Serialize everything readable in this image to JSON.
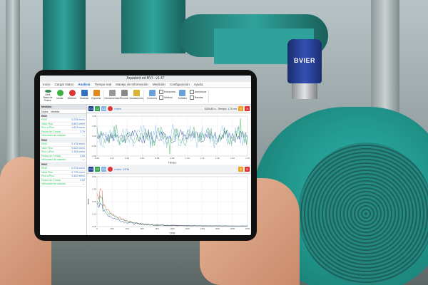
{
  "scene": {
    "sensor_label": "BVIER",
    "colors": {
      "motor": "#22998f",
      "sensor": "#2b43a0",
      "skin": "#d9a083"
    }
  },
  "app": {
    "window_title": "Aquabird ed BVI - v1.47",
    "tabs": [
      "Inicio",
      "Cargar Datos",
      "Análisis",
      "Tiempo real",
      "Manejo de Información",
      "Medición",
      "Configuración",
      "Ayuda"
    ],
    "active_tab": "Análisis",
    "ribbon": {
      "buttons": [
        "Abrir Base de Datos",
        "Iniciar",
        "Detener",
        "Guardar",
        "Exportar"
      ],
      "dropdowns": [
        "Herramientas",
        "Recorte",
        "Anotaciones",
        "Cursores",
        "Señales"
      ],
      "checks": [
        "Horizontal",
        "Vertical",
        "Armónicos",
        "Bandas"
      ]
    }
  },
  "panel": {
    "title": "Medidas",
    "subtabs": [
      "Datos",
      "Medida"
    ],
    "groups": [
      {
        "name": "RMS",
        "rows": [
          {
            "k": "RMS",
            "v": "0.235 mm/s"
          },
          {
            "k": "Valor Pico",
            "v": "0.891 mm/s"
          },
          {
            "k": "Pico a Pico",
            "v": "1.622 mm/s"
          },
          {
            "k": "Factor de Cresta",
            "v": "3.79"
          },
          {
            "k": "Velocidad de rotación",
            "v": "—"
          }
        ]
      },
      {
        "name": "RMS",
        "rows": [
          {
            "k": "RMS",
            "v": "0.176 mm/s"
          },
          {
            "k": "Valor Pico",
            "v": "0.642 mm/s"
          },
          {
            "k": "Pico a Pico",
            "v": "1.183 mm/s"
          },
          {
            "k": "Factor de Cresta",
            "v": "3.65"
          },
          {
            "k": "Velocidad de rotación",
            "v": "—"
          }
        ]
      },
      {
        "name": "RMS",
        "rows": [
          {
            "k": "RMS",
            "v": "0.214 mm/s"
          },
          {
            "k": "Valor Pico",
            "v": "0.775 mm/s"
          },
          {
            "k": "Pico a Pico",
            "v": "1.402 mm/s"
          },
          {
            "k": "Factor de Cresta",
            "v": "3.62"
          },
          {
            "k": "Velocidad de rotación",
            "v": "—"
          }
        ]
      }
    ]
  },
  "toolbar1": {
    "chips": [
      "C1",
      "C2",
      "C3"
    ],
    "readout": "1528,82 s - Tiempo: 1,70 ms",
    "unit": "mm/s"
  },
  "toolbar2": {
    "chips": [
      "C1",
      "C2",
      "C3"
    ],
    "readout": "CPM",
    "unit": "mm/s"
  },
  "chart_data": [
    {
      "type": "line",
      "title": "",
      "xlabel": "Tiempo",
      "ylabel": "",
      "xlim": [
        0,
        1.7
      ],
      "ylim": [
        -1,
        1
      ],
      "series": [
        {
          "color": "#1c3f8f"
        },
        {
          "color": "#2ea34a"
        },
        {
          "color": "#7fb4e6"
        }
      ]
    },
    {
      "type": "line",
      "title": "",
      "xlabel": "CPM",
      "ylabel": "mm/s",
      "xlim": [
        0,
        2000
      ],
      "ylim": [
        0,
        0.5
      ],
      "series": [
        {
          "color": "#d04040"
        },
        {
          "color": "#2ea34a"
        },
        {
          "color": "#1c3f8f"
        }
      ]
    }
  ]
}
